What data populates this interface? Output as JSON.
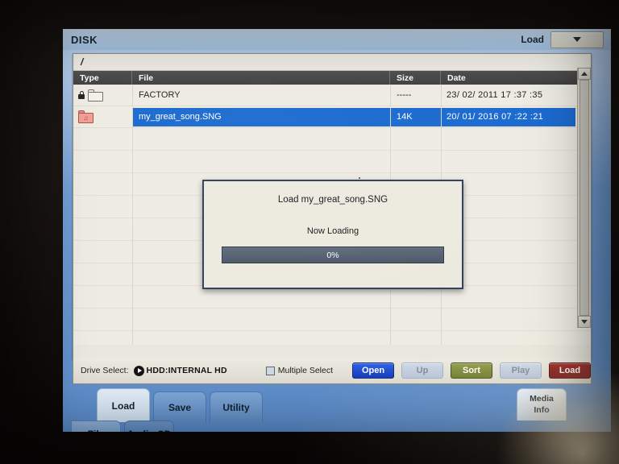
{
  "window": {
    "title": "DISK",
    "mode_label": "Load",
    "dropdown_icon": "chevron-down-icon"
  },
  "browser": {
    "path": "/",
    "columns": [
      "Type",
      "File",
      "Size",
      "Date"
    ],
    "rows": [
      {
        "icons": [
          "lock-icon",
          "folder-icon"
        ],
        "file": "FACTORY",
        "size": "-----",
        "date": "23/ 02/ 2011   17 :37 :35",
        "selected": false
      },
      {
        "icons": [
          "song-file-icon"
        ],
        "file": "my_great_song.SNG",
        "size": "14K",
        "date": "20/ 01/ 2016   07 :22 :21",
        "selected": true
      }
    ],
    "empty_row_count": 9,
    "scrollbar": {
      "up_icon": "scroll-up-arrow-icon",
      "down_icon": "scroll-down-arrow-icon"
    }
  },
  "controls": {
    "drive_select_label": "Drive Select:",
    "drive_select_icon": "drive-arrow-icon",
    "drive_select_value": "HDD:INTERNAL HD",
    "multiple_select_label": "Multiple Select",
    "multiple_select_checked": false,
    "buttons": [
      {
        "label": "Open",
        "state": "enabled",
        "color": "#1238b8"
      },
      {
        "label": "Up",
        "state": "disabled",
        "color": "#b8c6d9"
      },
      {
        "label": "Sort",
        "state": "enabled",
        "color": "#6f7c2f"
      },
      {
        "label": "Play",
        "state": "disabled",
        "color": "#b8c6d9"
      },
      {
        "label": "Load",
        "state": "enabled",
        "color": "#771715"
      }
    ]
  },
  "dialog": {
    "title": "Load my_great_song.SNG",
    "status": "Now Loading",
    "progress_text": "0%",
    "progress_percent": 0
  },
  "tabs": {
    "primary": [
      {
        "label": "Load",
        "active": true
      },
      {
        "label": "Save",
        "active": false
      },
      {
        "label": "Utility",
        "active": false
      }
    ],
    "secondary": [
      {
        "label": "File",
        "active": true
      },
      {
        "label": "Audio CD",
        "active": false
      }
    ],
    "media_info": {
      "line1": "Media",
      "line2": "Info"
    }
  },
  "colors": {
    "selection_blue": "#1667cf",
    "title_bar": "#b2cde9",
    "panel_blue": "#5b8bc9",
    "list_bg": "#edebe2"
  }
}
